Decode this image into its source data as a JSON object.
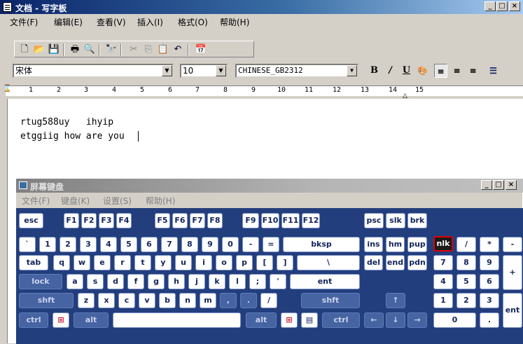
{
  "window": {
    "title": "文档 - 写字板",
    "min": "_",
    "max": "□",
    "close": "×"
  },
  "menu": [
    "文件(F)",
    "编辑(E)",
    "查看(V)",
    "插入(I)",
    "格式(O)",
    "帮助(H)"
  ],
  "toolbar": {
    "icons": [
      "new-icon",
      "open-icon",
      "save-icon",
      "print-icon",
      "print-preview-icon",
      "find-icon",
      "cut-icon",
      "copy-icon",
      "paste-icon",
      "undo-icon",
      "insert-datetime-icon"
    ]
  },
  "format": {
    "font": "宋体",
    "size": "10",
    "script": "CHINESE_GB2312",
    "bold": "B",
    "italic": "/",
    "underline": "U"
  },
  "ruler": {
    "marks": [
      "1",
      "2",
      "3",
      "4",
      "5",
      "6",
      "7",
      "8",
      "9",
      "10",
      "11",
      "12",
      "13",
      "14",
      "15"
    ]
  },
  "document": {
    "lines": [
      "rtug588uy   ihyip",
      "etggiig how are you"
    ]
  },
  "osk": {
    "title": "屏幕键盘",
    "menu": [
      "文件(F)",
      "键盘(K)",
      "设置(S)",
      "帮助(H)"
    ],
    "row0": [
      "esc",
      "F1",
      "F2",
      "F3",
      "F4",
      "F5",
      "F6",
      "F7",
      "F8",
      "F9",
      "F10",
      "F11",
      "F12",
      "psc",
      "slk",
      "brk"
    ],
    "row1": [
      "`",
      "1",
      "2",
      "3",
      "4",
      "5",
      "6",
      "7",
      "8",
      "9",
      "0",
      "-",
      "=",
      "bksp",
      "ins",
      "hm",
      "pup",
      "nlk",
      "/",
      "*",
      "-"
    ],
    "row2": [
      "tab",
      "q",
      "w",
      "e",
      "r",
      "t",
      "y",
      "u",
      "i",
      "o",
      "p",
      "[",
      "]",
      "\\",
      "del",
      "end",
      "pdn",
      "7",
      "8",
      "9",
      "+"
    ],
    "row3": [
      "lock",
      "a",
      "s",
      "d",
      "f",
      "g",
      "h",
      "j",
      "k",
      "l",
      ";",
      "'",
      "ent",
      "4",
      "5",
      "6"
    ],
    "row4": [
      "shft",
      "z",
      "x",
      "c",
      "v",
      "b",
      "n",
      "m",
      ",",
      ".",
      "/",
      "shft",
      "↑",
      "1",
      "2",
      "3",
      "ent"
    ],
    "row5": [
      "ctrl",
      "⊞",
      "alt",
      "alt",
      "⊞",
      "▤",
      "ctrl",
      "←",
      "↓",
      "→",
      "0",
      "."
    ]
  },
  "colors": {
    "titlebar": "#0a246a",
    "keyboard": "#233e7c",
    "key_highlight": "#e00000"
  }
}
